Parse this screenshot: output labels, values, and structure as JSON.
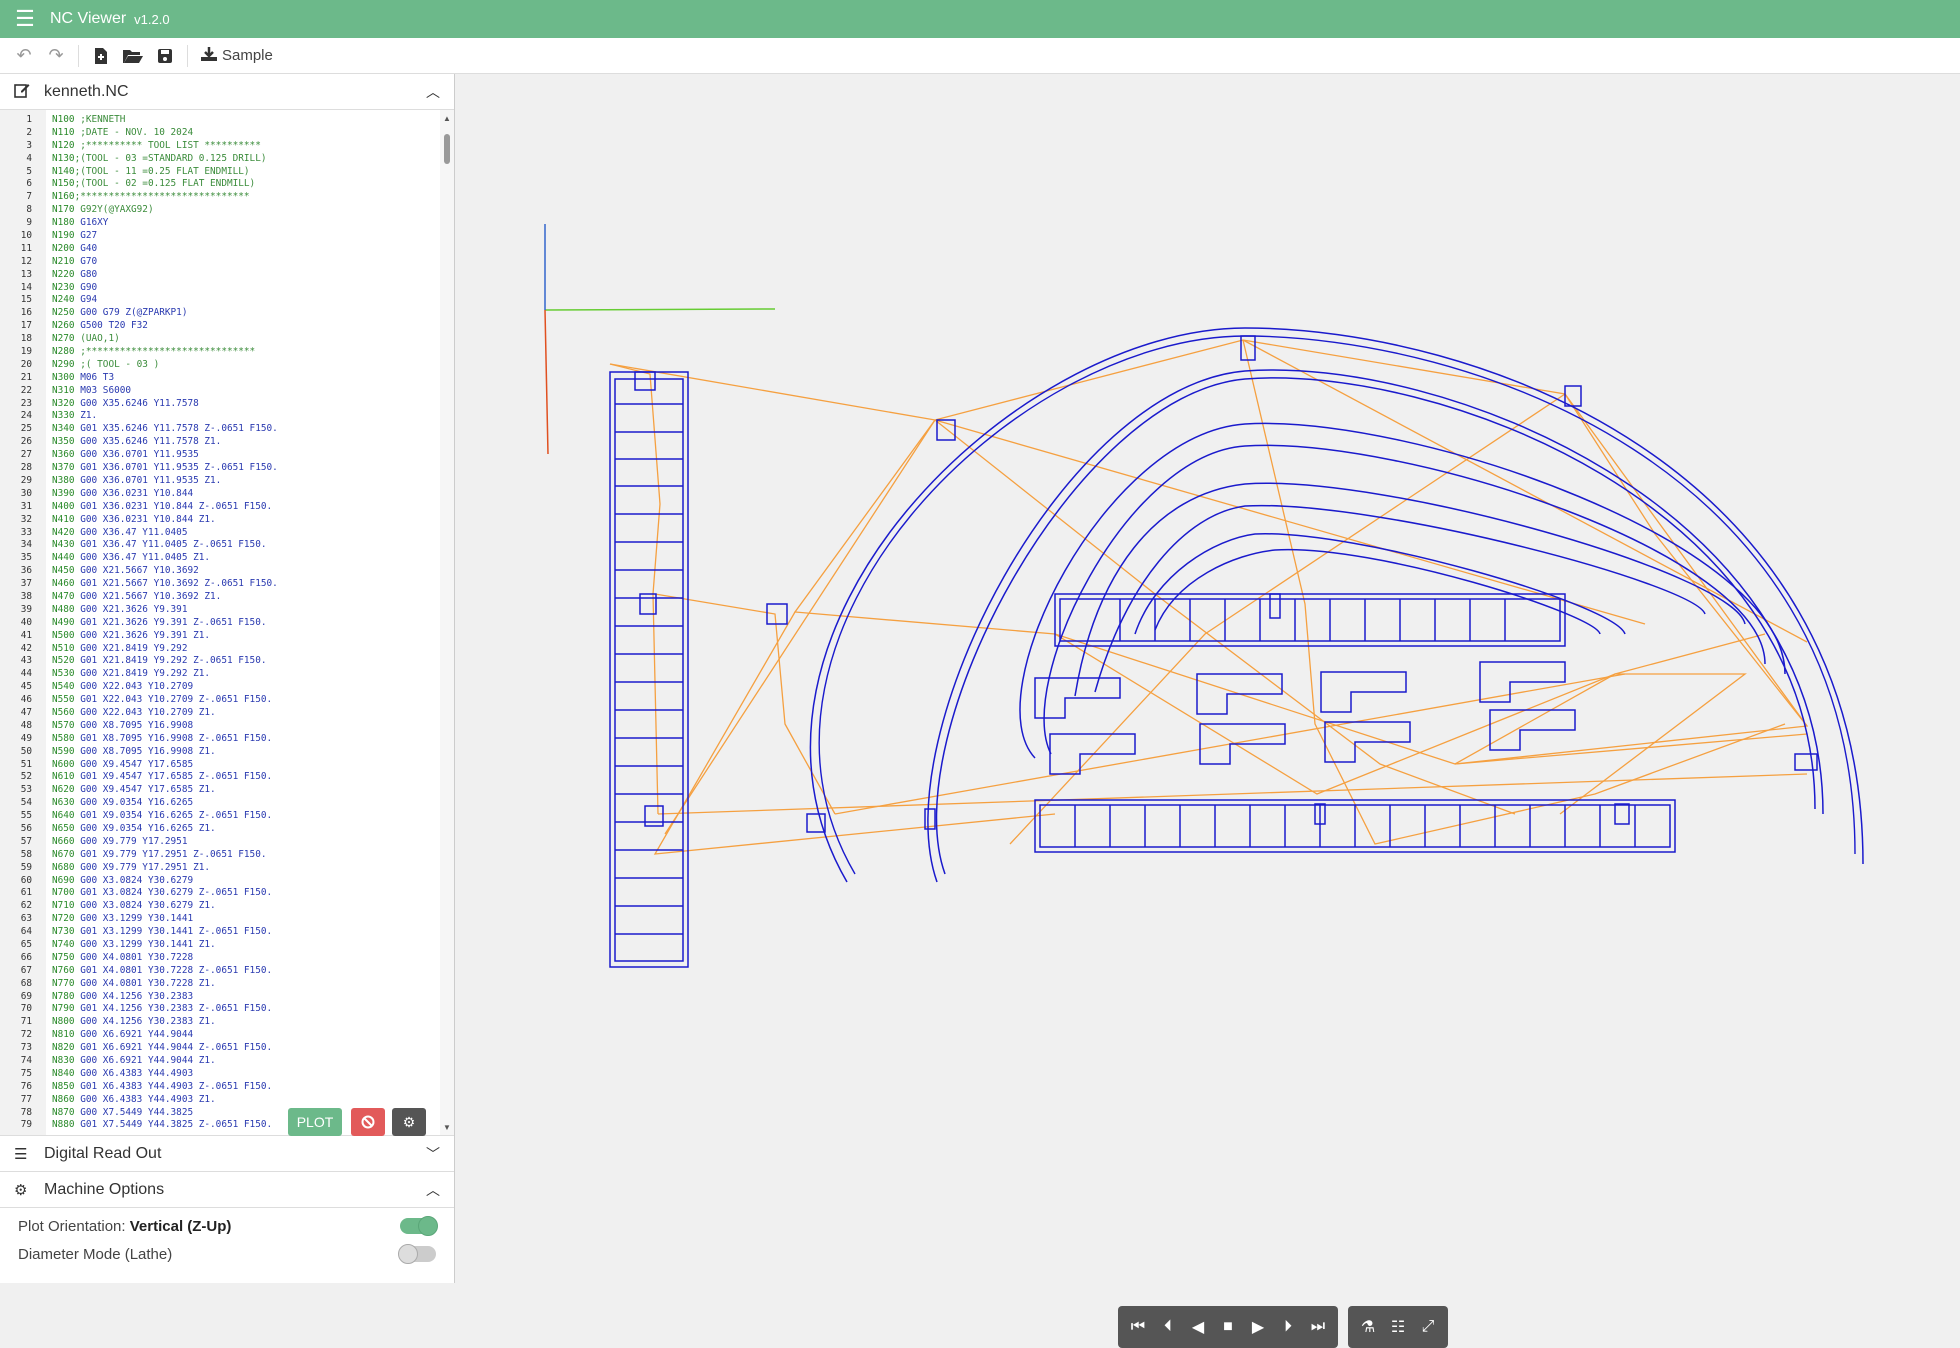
{
  "app": {
    "title": "NC Viewer",
    "version": "v1.2.0"
  },
  "toolbar": {
    "sample_label": "Sample"
  },
  "editor": {
    "filename": "kenneth.NC",
    "lines": [
      "N100 ;KENNETH",
      "N110 ;DATE - NOV. 10 2024",
      "N120 ;********** TOOL LIST **********",
      "N130;(TOOL - 03 =STANDARD 0.125 DRILL)",
      "N140;(TOOL - 11 =0.25 FLAT ENDMILL)",
      "N150;(TOOL - 02 =0.125 FLAT ENDMILL)",
      "N160;******************************",
      "N170 G92Y(@YAXG92)",
      "N180 G16XY",
      "N190 G27",
      "N200 G40",
      "N210 G70",
      "N220 G80",
      "N230 G90",
      "N240 G94",
      "N250 G00 G79 Z(@ZPARKP1)",
      "N260 G500 T20 F32",
      "N270 (UAO,1)",
      "N280 ;******************************",
      "N290 ;( TOOL - 03 )",
      "N300 M06 T3",
      "N310 M03 S6000",
      "N320 G00 X35.6246 Y11.7578",
      "N330 Z1.",
      "N340 G01 X35.6246 Y11.7578 Z-.0651 F150.",
      "N350 G00 X35.6246 Y11.7578 Z1.",
      "N360 G00 X36.0701 Y11.9535",
      "N370 G01 X36.0701 Y11.9535 Z-.0651 F150.",
      "N380 G00 X36.0701 Y11.9535 Z1.",
      "N390 G00 X36.0231 Y10.844",
      "N400 G01 X36.0231 Y10.844 Z-.0651 F150.",
      "N410 G00 X36.0231 Y10.844 Z1.",
      "N420 G00 X36.47 Y11.0405",
      "N430 G01 X36.47 Y11.0405 Z-.0651 F150.",
      "N440 G00 X36.47 Y11.0405 Z1.",
      "N450 G00 X21.5667 Y10.3692",
      "N460 G01 X21.5667 Y10.3692 Z-.0651 F150.",
      "N470 G00 X21.5667 Y10.3692 Z1.",
      "N480 G00 X21.3626 Y9.391",
      "N490 G01 X21.3626 Y9.391 Z-.0651 F150.",
      "N500 G00 X21.3626 Y9.391 Z1.",
      "N510 G00 X21.8419 Y9.292",
      "N520 G01 X21.8419 Y9.292 Z-.0651 F150.",
      "N530 G00 X21.8419 Y9.292 Z1.",
      "N540 G00 X22.043 Y10.2709",
      "N550 G01 X22.043 Y10.2709 Z-.0651 F150.",
      "N560 G00 X22.043 Y10.2709 Z1.",
      "N570 G00 X8.7095 Y16.9908",
      "N580 G01 X8.7095 Y16.9908 Z-.0651 F150.",
      "N590 G00 X8.7095 Y16.9908 Z1.",
      "N600 G00 X9.4547 Y17.6585",
      "N610 G01 X9.4547 Y17.6585 Z-.0651 F150.",
      "N620 G00 X9.4547 Y17.6585 Z1.",
      "N630 G00 X9.0354 Y16.6265",
      "N640 G01 X9.0354 Y16.6265 Z-.0651 F150.",
      "N650 G00 X9.0354 Y16.6265 Z1.",
      "N660 G00 X9.779 Y17.2951",
      "N670 G01 X9.779 Y17.2951 Z-.0651 F150.",
      "N680 G00 X9.779 Y17.2951 Z1.",
      "N690 G00 X3.0824 Y30.6279",
      "N700 G01 X3.0824 Y30.6279 Z-.0651 F150.",
      "N710 G00 X3.0824 Y30.6279 Z1.",
      "N720 G00 X3.1299 Y30.1441",
      "N730 G01 X3.1299 Y30.1441 Z-.0651 F150.",
      "N740 G00 X3.1299 Y30.1441 Z1.",
      "N750 G00 X4.0801 Y30.7228",
      "N760 G01 X4.0801 Y30.7228 Z-.0651 F150.",
      "N770 G00 X4.0801 Y30.7228 Z1.",
      "N780 G00 X4.1256 Y30.2383",
      "N790 G01 X4.1256 Y30.2383 Z-.0651 F150.",
      "N800 G00 X4.1256 Y30.2383 Z1.",
      "N810 G00 X6.6921 Y44.9044",
      "N820 G01 X6.6921 Y44.9044 Z-.0651 F150.",
      "N830 G00 X6.6921 Y44.9044 Z1.",
      "N840 G00 X6.4383 Y44.4903",
      "N850 G01 X6.4383 Y44.4903 Z-.0651 F150.",
      "N860 G00 X6.4383 Y44.4903 Z1.",
      "N870 G00 X7.5449 Y44.3825",
      "N880 G01 X7.5449 Y44.3825 Z-.0651 F150."
    ],
    "plot_label": "PLOT"
  },
  "panels": {
    "dro_label": "Digital Read Out",
    "machine_label": "Machine Options"
  },
  "machine_options": {
    "orientation_label": "Plot Orientation:",
    "orientation_value": "Vertical (Z-Up)",
    "orientation_on": true,
    "diameter_label": "Diameter Mode (Lathe)",
    "diameter_on": false
  },
  "colors": {
    "accent": "#6cb98a",
    "toolpath_cut": "#1a1acc",
    "toolpath_rapid": "#f5a040",
    "axis_x": "#66cc33",
    "axis_y": "#3366cc",
    "axis_z": "#e05020"
  }
}
